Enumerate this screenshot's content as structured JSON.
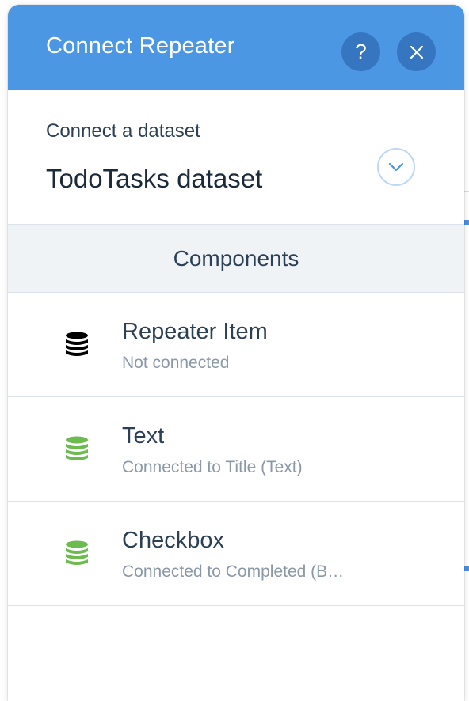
{
  "header": {
    "title": "Connect Repeater",
    "help_label": "?",
    "close_label": "×"
  },
  "dataset": {
    "label": "Connect a dataset",
    "selected": "TodoTasks dataset"
  },
  "components": {
    "heading": "Components",
    "items": [
      {
        "name": "Repeater Item",
        "status": "Not connected",
        "icon": "database-icon",
        "icon_color": "#000000"
      },
      {
        "name": "Text",
        "status": "Connected to Title (Text)",
        "icon": "database-icon",
        "icon_color": "#6cbb4f"
      },
      {
        "name": "Checkbox",
        "status": "Connected to Completed (B…",
        "icon": "database-icon",
        "icon_color": "#6cbb4f"
      }
    ]
  },
  "colors": {
    "header_bg": "#4b97e3",
    "header_button_bg": "#3676c1",
    "connected": "#6cbb4f",
    "not_connected": "#000000"
  }
}
